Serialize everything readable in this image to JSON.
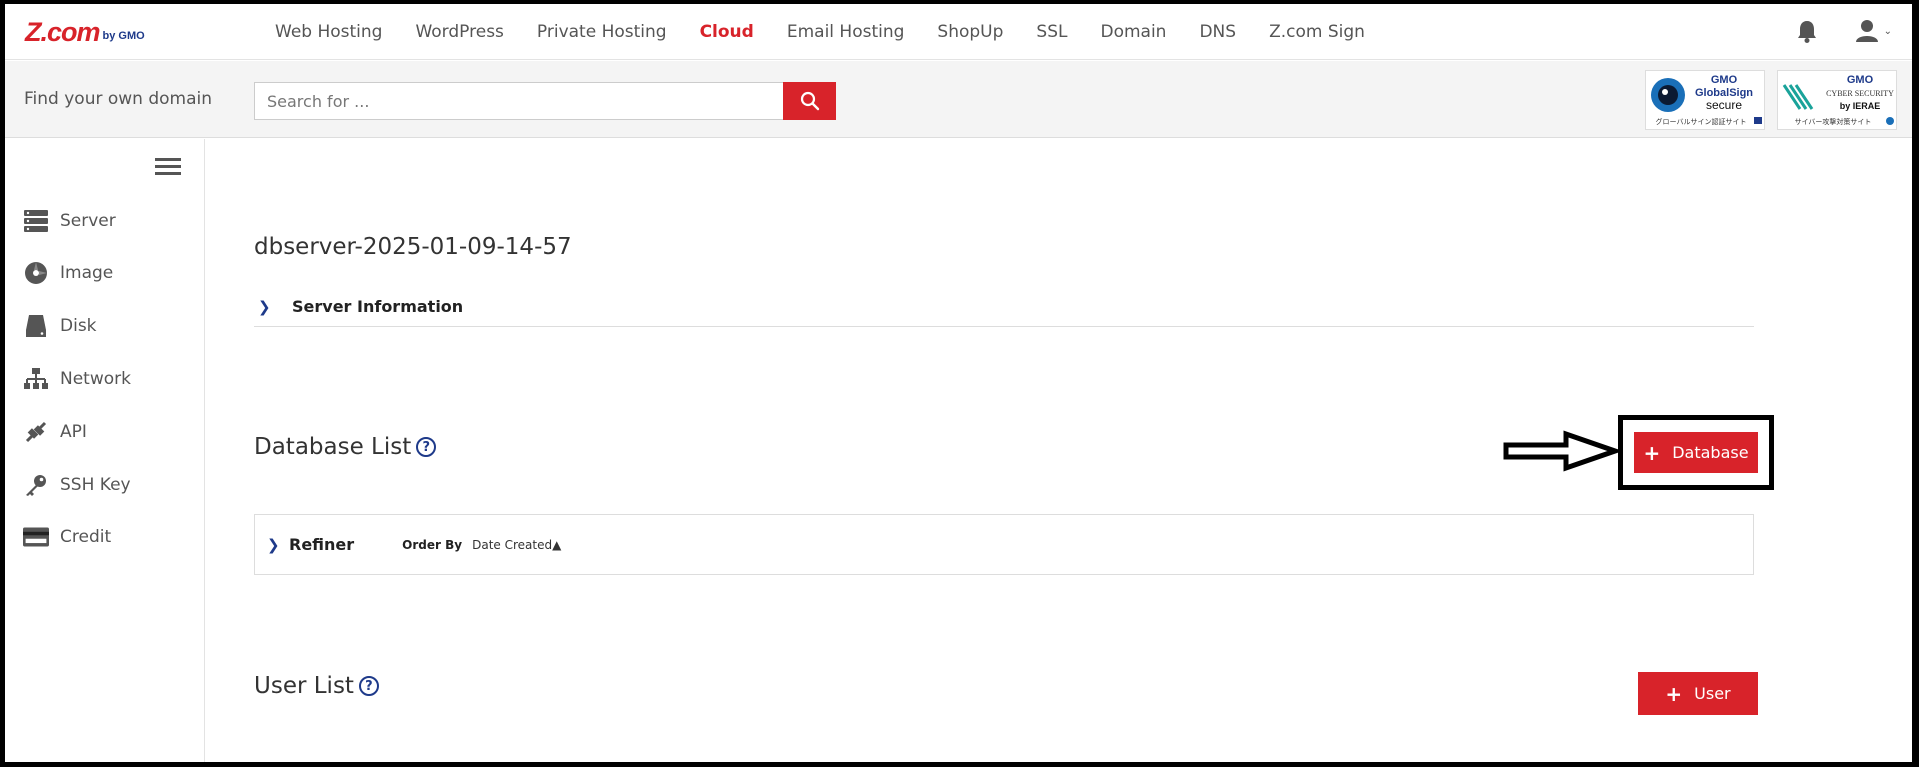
{
  "logo": {
    "main": "Z.com",
    "sub": "by GMO"
  },
  "nav": {
    "items": [
      {
        "label": "Web Hosting",
        "active": false
      },
      {
        "label": "WordPress",
        "active": false
      },
      {
        "label": "Private Hosting",
        "active": false
      },
      {
        "label": "Cloud",
        "active": true
      },
      {
        "label": "Email Hosting",
        "active": false
      },
      {
        "label": "ShopUp",
        "active": false
      },
      {
        "label": "SSL",
        "active": false
      },
      {
        "label": "Domain",
        "active": false
      },
      {
        "label": "DNS",
        "active": false
      },
      {
        "label": "Z.com Sign",
        "active": false
      }
    ]
  },
  "search": {
    "label": "Find your own domain",
    "placeholder": "Search for ...",
    "value": ""
  },
  "badges": {
    "globalsign": {
      "line1": "GMO",
      "line2": "GlobalSign",
      "line3": "secure",
      "caption": "グローバルサイン認証サイト"
    },
    "cyber": {
      "line1": "GMO",
      "line2": "CYBER SECURITY",
      "line3": "by IERAE",
      "caption": "サイバー攻撃対策サイト"
    }
  },
  "sidebar": {
    "items": [
      {
        "label": "Server",
        "icon": "server-icon"
      },
      {
        "label": "Image",
        "icon": "image-icon"
      },
      {
        "label": "Disk",
        "icon": "disk-icon"
      },
      {
        "label": "Network",
        "icon": "network-icon"
      },
      {
        "label": "API",
        "icon": "api-icon"
      },
      {
        "label": "SSH Key",
        "icon": "key-icon"
      },
      {
        "label": "Credit",
        "icon": "credit-card-icon"
      }
    ]
  },
  "main": {
    "server_name": "dbserver-2025-01-09-14-57",
    "server_info_label": "Server Information",
    "database_list_title": "Database List",
    "database_button": "Database",
    "refiner_label": "Refiner",
    "order_by_label": "Order By",
    "order_by_value": "Date Created▲",
    "user_list_title": "User List",
    "user_button": "User"
  },
  "colors": {
    "brand_red": "#d8232a",
    "accent_blue": "#1e3a8a"
  }
}
